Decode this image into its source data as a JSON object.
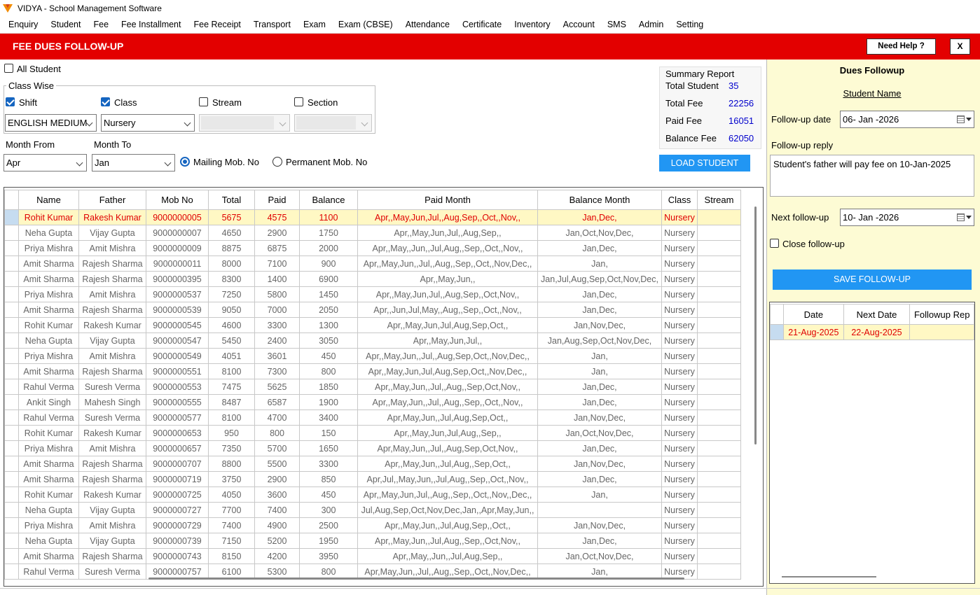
{
  "window": {
    "title": "VIDYA - School Management Software"
  },
  "menu": [
    "Enquiry",
    "Student",
    "Fee",
    "Fee Installment",
    "Fee Receipt",
    "Transport",
    "Exam",
    "Exam (CBSE)",
    "Attendance",
    "Certificate",
    "Inventory",
    "Account",
    "SMS",
    "Admin",
    "Setting"
  ],
  "header": {
    "title": "FEE DUES FOLLOW-UP",
    "help_label": "Need Help ?",
    "close_label": "X"
  },
  "filters": {
    "all_student": {
      "label": "All Student",
      "checked": false
    },
    "class_wise_label": "Class Wise",
    "shift": {
      "label": "Shift",
      "checked": true,
      "value": "ENGLISH MEDIUM"
    },
    "class": {
      "label": "Class",
      "checked": true,
      "value": "Nursery"
    },
    "stream": {
      "label": "Stream",
      "checked": false,
      "value": ""
    },
    "section": {
      "label": "Section",
      "checked": false,
      "value": ""
    },
    "month_from": {
      "label": "Month From",
      "value": "Apr"
    },
    "month_to": {
      "label": "Month To",
      "value": "Jan"
    },
    "mailing_mob": {
      "label": "Mailing Mob. No",
      "selected": true
    },
    "permanent_mob": {
      "label": "Permanent Mob. No",
      "selected": false
    },
    "load_button": "LOAD STUDENT"
  },
  "summary": {
    "title": "Summary Report",
    "rows": [
      {
        "label": "Total Student",
        "value": "35"
      },
      {
        "label": "Total Fee",
        "value": "22256"
      },
      {
        "label": "Paid Fee",
        "value": "16051"
      },
      {
        "label": "Balance Fee",
        "value": "62050"
      }
    ]
  },
  "grid": {
    "columns": [
      "Name",
      "Father",
      "Mob No",
      "Total",
      "Paid",
      "Balance",
      "Paid Month",
      "Balance Month",
      "Class",
      "Stream"
    ],
    "rows": [
      [
        "Rohit Kumar",
        "Rakesh Kumar",
        "9000000005",
        "5675",
        "4575",
        "1100",
        "Apr,,May,Jun,Jul,,Aug,Sep,,Oct,,Nov,,",
        "Jan,Dec,",
        "Nursery",
        ""
      ],
      [
        "Neha Gupta",
        "Vijay Gupta",
        "9000000007",
        "4650",
        "2900",
        "1750",
        "Apr,,May,Jun,Jul,,Aug,Sep,,",
        "Jan,Oct,Nov,Dec,",
        "Nursery",
        ""
      ],
      [
        "Priya Mishra",
        "Amit Mishra",
        "9000000009",
        "8875",
        "6875",
        "2000",
        "Apr,,May,,Jun,,Jul,Aug,,Sep,,Oct,,Nov,,",
        "Jan,Dec,",
        "Nursery",
        ""
      ],
      [
        "Amit Sharma",
        "Rajesh Sharma",
        "9000000011",
        "8000",
        "7100",
        "900",
        "Apr,,May,Jun,,Jul,,Aug,,Sep,,Oct,,Nov,Dec,,",
        "Jan,",
        "Nursery",
        ""
      ],
      [
        "Amit Sharma",
        "Rajesh Sharma",
        "9000000395",
        "8300",
        "1400",
        "6900",
        "Apr,,May,Jun,,",
        "Jan,Jul,Aug,Sep,Oct,Nov,Dec,",
        "Nursery",
        ""
      ],
      [
        "Priya Mishra",
        "Amit Mishra",
        "9000000537",
        "7250",
        "5800",
        "1450",
        "Apr,,May,Jun,Jul,,Aug,Sep,,Oct,Nov,,",
        "Jan,Dec,",
        "Nursery",
        ""
      ],
      [
        "Amit Sharma",
        "Rajesh Sharma",
        "9000000539",
        "9050",
        "7000",
        "2050",
        "Apr,,Jun,Jul,May,,Aug,,Sep,,Oct,,Nov,,",
        "Jan,Dec,",
        "Nursery",
        ""
      ],
      [
        "Rohit Kumar",
        "Rakesh Kumar",
        "9000000545",
        "4600",
        "3300",
        "1300",
        "Apr,,May,Jun,Jul,Aug,Sep,Oct,,",
        "Jan,Nov,Dec,",
        "Nursery",
        ""
      ],
      [
        "Neha Gupta",
        "Vijay Gupta",
        "9000000547",
        "5450",
        "2400",
        "3050",
        "Apr,,May,Jun,Jul,,",
        "Jan,Aug,Sep,Oct,Nov,Dec,",
        "Nursery",
        ""
      ],
      [
        "Priya Mishra",
        "Amit Mishra",
        "9000000549",
        "4051",
        "3601",
        "450",
        "Apr,,May,Jun,,Jul,,Aug,Sep,Oct,,Nov,Dec,,",
        "Jan,",
        "Nursery",
        ""
      ],
      [
        "Amit Sharma",
        "Rajesh Sharma",
        "9000000551",
        "8100",
        "7300",
        "800",
        "Apr,,May,Jun,Jul,Aug,Sep,Oct,,Nov,Dec,,",
        "Jan,",
        "Nursery",
        ""
      ],
      [
        "Rahul Verma",
        "Suresh Verma",
        "9000000553",
        "7475",
        "5625",
        "1850",
        "Apr,,May,Jun,,Jul,,Aug,,Sep,Oct,Nov,,",
        "Jan,Dec,",
        "Nursery",
        ""
      ],
      [
        "Ankit Singh",
        "Mahesh Singh",
        "9000000555",
        "8487",
        "6587",
        "1900",
        "Apr,,May,Jun,,Jul,,Aug,,Sep,,Oct,,Nov,,",
        "Jan,Dec,",
        "Nursery",
        ""
      ],
      [
        "Rahul Verma",
        "Suresh Verma",
        "9000000577",
        "8100",
        "4700",
        "3400",
        "Apr,May,Jun,,Jul,Aug,Sep,Oct,,",
        "Jan,Nov,Dec,",
        "Nursery",
        ""
      ],
      [
        "Rohit Kumar",
        "Rakesh Kumar",
        "9000000653",
        "950",
        "800",
        "150",
        "Apr,,May,Jun,Jul,Aug,,Sep,,",
        "Jan,Oct,Nov,Dec,",
        "Nursery",
        ""
      ],
      [
        "Priya Mishra",
        "Amit Mishra",
        "9000000657",
        "7350",
        "5700",
        "1650",
        "Apr,May,Jun,,Jul,,Aug,Sep,Oct,Nov,,",
        "Jan,Dec,",
        "Nursery",
        ""
      ],
      [
        "Amit Sharma",
        "Rajesh Sharma",
        "9000000707",
        "8800",
        "5500",
        "3300",
        "Apr,,May,Jun,,Jul,Aug,,Sep,Oct,,",
        "Jan,Nov,Dec,",
        "Nursery",
        ""
      ],
      [
        "Amit Sharma",
        "Rajesh Sharma",
        "9000000719",
        "3750",
        "2900",
        "850",
        "Apr,Jul,,May,Jun,,Jul,Aug,,Sep,,Oct,,Nov,,",
        "Jan,Dec,",
        "Nursery",
        ""
      ],
      [
        "Rohit Kumar",
        "Rakesh Kumar",
        "9000000725",
        "4050",
        "3600",
        "450",
        "Apr,,May,Jun,Jul,,Aug,,Sep,,Oct,,Nov,,Dec,,",
        "Jan,",
        "Nursery",
        ""
      ],
      [
        "Neha Gupta",
        "Vijay Gupta",
        "9000000727",
        "7700",
        "7400",
        "300",
        "Jul,Aug,Sep,Oct,Nov,Dec,Jan,,Apr,May,Jun,,",
        "",
        "Nursery",
        ""
      ],
      [
        "Priya Mishra",
        "Amit Mishra",
        "9000000729",
        "7400",
        "4900",
        "2500",
        "Apr,,May,Jun,,Jul,Aug,Sep,,Oct,,",
        "Jan,Nov,Dec,",
        "Nursery",
        ""
      ],
      [
        "Neha Gupta",
        "Vijay Gupta",
        "9000000739",
        "7150",
        "5200",
        "1950",
        "Apr,,May,Jun,,Jul,Aug,,Sep,,Oct,Nov,,",
        "Jan,Dec,",
        "Nursery",
        ""
      ],
      [
        "Amit Sharma",
        "Rajesh Sharma",
        "9000000743",
        "8150",
        "4200",
        "3950",
        "Apr,,May,,Jun,,Jul,Aug,Sep,,",
        "Jan,Oct,Nov,Dec,",
        "Nursery",
        ""
      ],
      [
        "Rahul Verma",
        "Suresh Verma",
        "9000000757",
        "6100",
        "5300",
        "800",
        "Apr,May,Jun,,Jul,,Aug,,Sep,,Oct,,Nov,Dec,,",
        "Jan,",
        "Nursery",
        ""
      ]
    ]
  },
  "followup": {
    "title": "Dues Followup",
    "student_name": "Student Name",
    "date_label": "Follow-up date",
    "date_value": "06- Jan -2026",
    "reply_label": "Follow-up reply",
    "reply_value": "Student's father will pay fee on 10-Jan-2025",
    "next_label": "Next follow-up",
    "next_value": "10- Jan -2026",
    "close_label": "Close follow-up",
    "close_checked": false,
    "save_button": "SAVE FOLLOW-UP",
    "columns": [
      "Date",
      "Next Date",
      "Followup Rep"
    ],
    "rows": [
      [
        "21-Aug-2025",
        "22-Aug-2025",
        ""
      ]
    ]
  },
  "colors": {
    "header_red": "#e30000",
    "accent_blue": "#2196f3",
    "value_blue": "#0000cc",
    "selected_row": "#fff8c4",
    "followup_panel": "#fdfbd4"
  }
}
